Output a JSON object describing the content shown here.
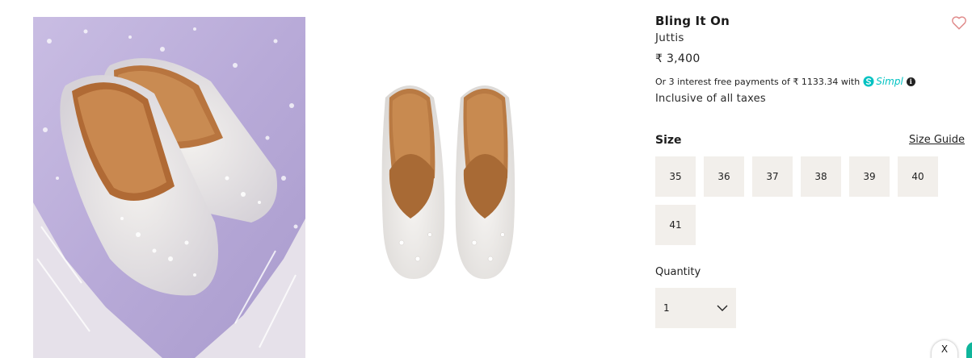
{
  "product": {
    "title": "Bling It On",
    "category": "Juttis",
    "price": "₹ 3,400",
    "emi_text": "Or 3 interest free payments of ₹ 1133.34 with",
    "emi_provider": "Simpl",
    "taxes_note": "Inclusive of all taxes"
  },
  "size": {
    "label": "Size",
    "guide_label": "Size Guide",
    "options": [
      "35",
      "36",
      "37",
      "38",
      "39",
      "40",
      "41"
    ]
  },
  "quantity": {
    "label": "Quantity",
    "value": "1"
  },
  "widget": {
    "close_label": "X"
  },
  "icons": {
    "wishlist": "heart-outline-icon",
    "info": "info-icon",
    "chevron": "chevron-down-icon"
  },
  "colors": {
    "swatch_bg": "#f2efeb",
    "heart": "#e08a8a",
    "simpl": "#00c2c2"
  }
}
